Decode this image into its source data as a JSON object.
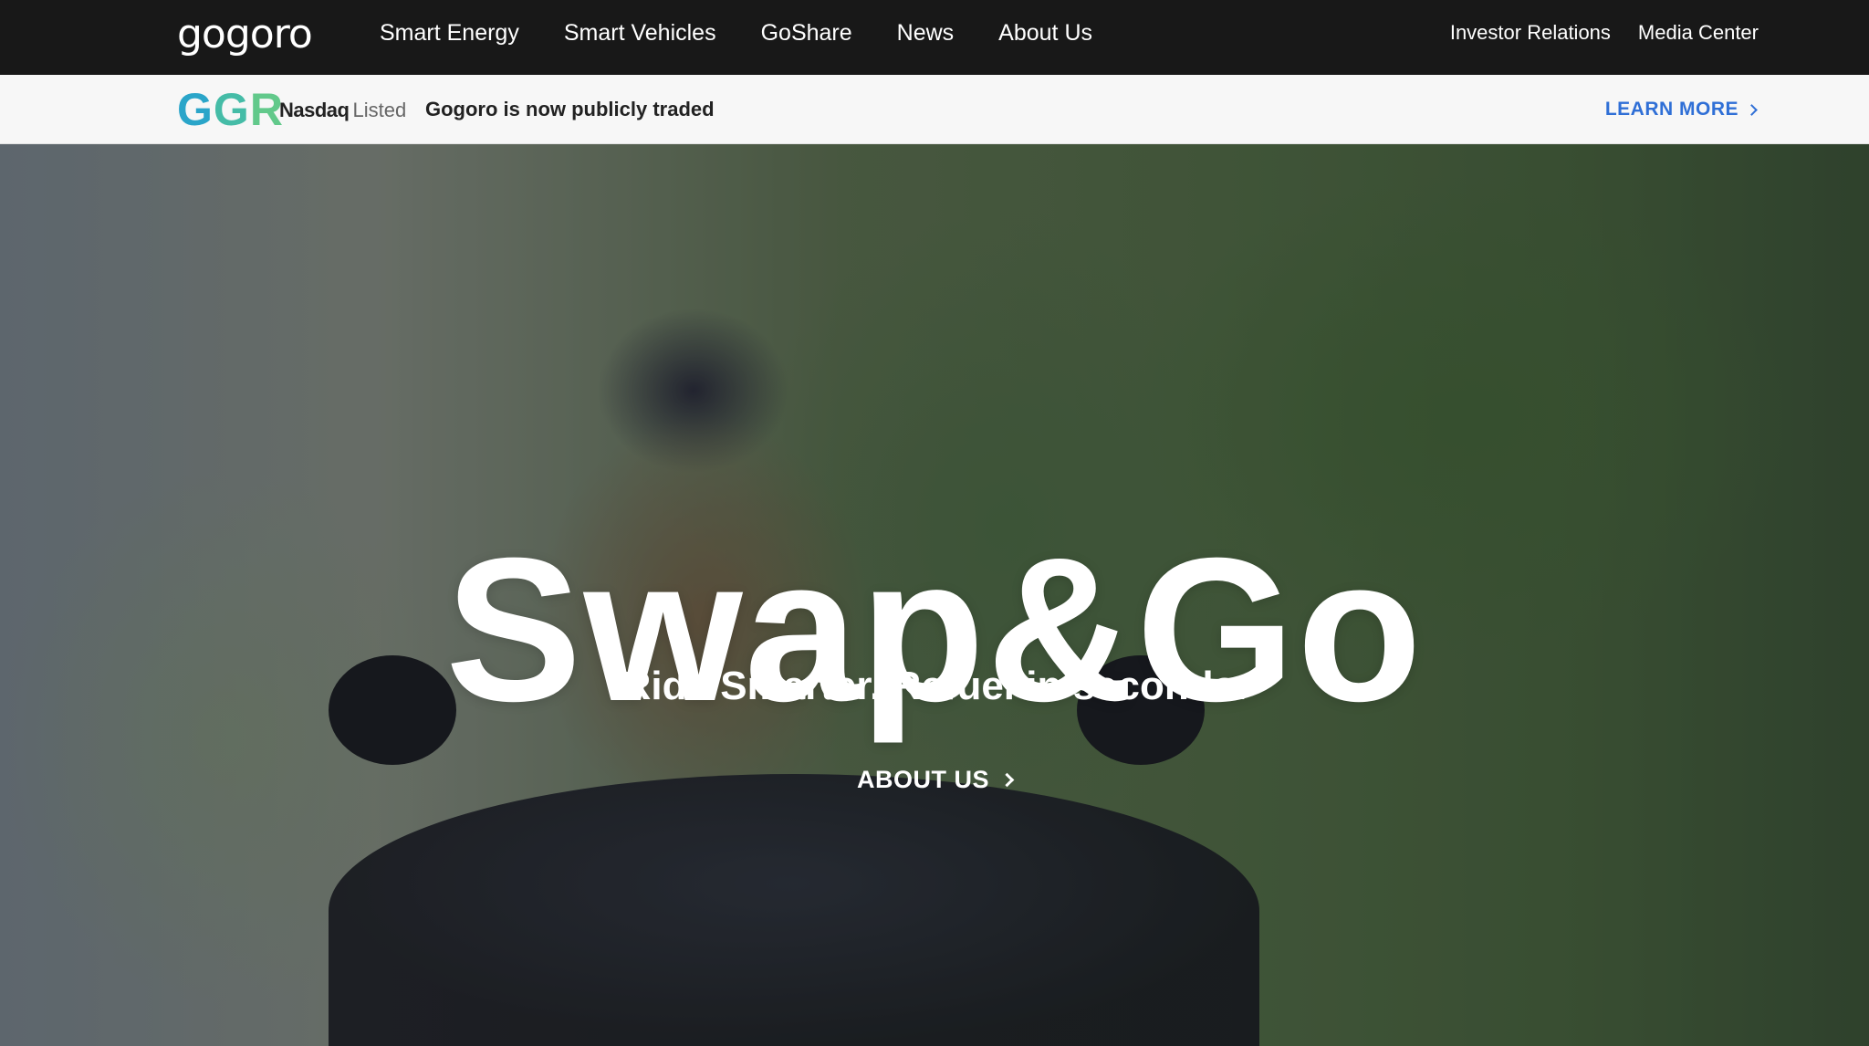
{
  "brand": {
    "logo_text": "gogoro"
  },
  "main_nav": {
    "items": [
      {
        "label": "Smart Energy"
      },
      {
        "label": "Smart Vehicles"
      },
      {
        "label": "GoShare"
      },
      {
        "label": "News"
      },
      {
        "label": "About Us"
      }
    ]
  },
  "secondary_nav": {
    "items": [
      {
        "label": "Investor Relations"
      },
      {
        "label": "Media Center"
      }
    ]
  },
  "announcement": {
    "ticker_g1": "G",
    "ticker_g2": "G",
    "ticker_r": "R",
    "exchange": "Nasdaq",
    "listed": "Listed",
    "message": "Gogoro is now publicly traded",
    "cta_label": "LEARN MORE"
  },
  "hero": {
    "title": "Swap&Go",
    "subtitle": "Ride Smarter. Refuel in seconds.",
    "cta_label": "ABOUT US"
  },
  "icons": {
    "learn_more": "chevron-right-icon",
    "about_us": "chevron-right-icon"
  },
  "colors": {
    "nav_background": "#181818",
    "announcement_background": "#f7f7f7",
    "ticker_blue": "#2aa5c9",
    "ticker_teal": "#45bca7",
    "ticker_green": "#62c98b",
    "link_blue": "#2f6fd6"
  }
}
